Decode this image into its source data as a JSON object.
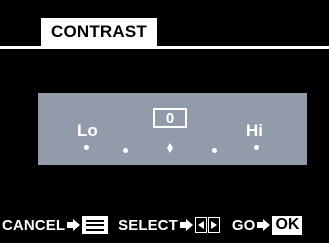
{
  "header": {
    "title": "CONTRAST"
  },
  "setting": {
    "low_label": "Lo",
    "high_label": "Hi",
    "current_value": "0",
    "scale_steps": 5,
    "selected_step_index": 2
  },
  "footer": {
    "cancel_label": "CANCEL",
    "cancel_icon": "menu-icon",
    "select_label": "SELECT",
    "select_icon": "left-right-icon",
    "go_label": "GO",
    "go_key_label": "OK"
  },
  "colors": {
    "background": "#000000",
    "panel": "#929ba9",
    "text": "#ffffff"
  }
}
